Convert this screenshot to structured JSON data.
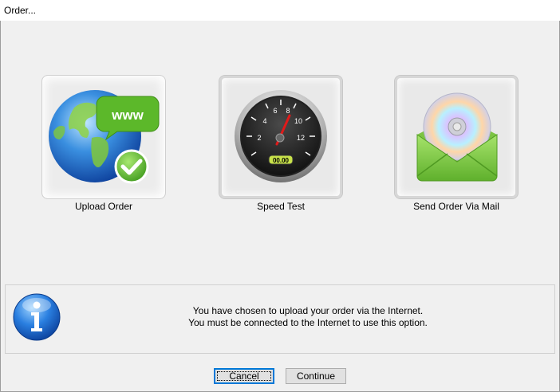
{
  "window": {
    "title": "Order..."
  },
  "options": [
    {
      "label": "Upload Order",
      "icon": "globe-www-icon",
      "selected": true
    },
    {
      "label": "Speed Test",
      "icon": "speedometer-icon",
      "selected": false
    },
    {
      "label": "Send Order Via Mail",
      "icon": "mail-cd-icon",
      "selected": false
    }
  ],
  "icons": {
    "www_badge": "www",
    "gauge_numbers": [
      "2",
      "4",
      "6",
      "8",
      "10",
      "12"
    ],
    "gauge_readout": "00.00"
  },
  "info": {
    "icon": "info-icon",
    "line1": "You have chosen to upload your order via the Internet.",
    "line2": "You must be connected to the Internet to use this option."
  },
  "buttons": {
    "cancel": "Cancel",
    "continue": "Continue"
  }
}
